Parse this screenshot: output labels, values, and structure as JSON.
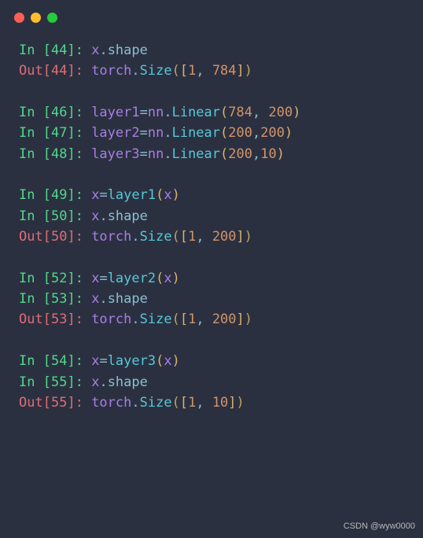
{
  "prompts": {
    "in": "In ",
    "out": "Out"
  },
  "nums": {
    "n44": "44",
    "n46": "46",
    "n47": "47",
    "n48": "48",
    "n49": "49",
    "n50": "50",
    "n52": "52",
    "n53": "53",
    "n54": "54",
    "n55": "55"
  },
  "tokens": {
    "x": "x",
    "dot": ".",
    "shape": "shape",
    "torch": "torch",
    "Size": "Size",
    "layer1": "layer1",
    "layer2": "layer2",
    "layer3": "layer3",
    "eq": "=",
    "nn": "nn",
    "Linear": "Linear",
    "lparen": "(",
    "rparen": ")",
    "lbrack": "[",
    "rbrack": "]",
    "colon_sp": ": ",
    "comma_sp": ", ",
    "comma": ",",
    "v1": "1",
    "v784": "784",
    "v200": "200",
    "v10": "10"
  },
  "watermark": "CSDN @wyw0000"
}
